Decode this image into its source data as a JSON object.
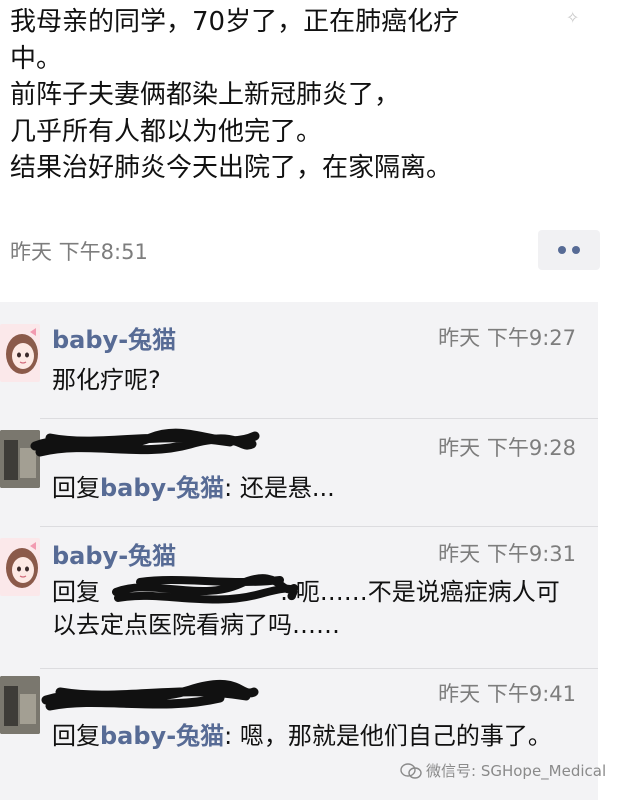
{
  "post": {
    "lines": [
      "我母亲的同学，70岁了，正在肺癌化疗",
      "中。",
      "前阵子夫妻俩都染上新冠肺炎了，",
      "几乎所有人都以为他完了。",
      "结果治好肺炎今天出院了，在家隔离。"
    ],
    "time": "昨天 下午8:51"
  },
  "comments": [
    {
      "name": "baby-兔猫",
      "time": "昨天 下午9:27",
      "text": "那化疗呢?"
    },
    {
      "name": "",
      "time": "昨天 下午9:28",
      "reply_prefix": "回复",
      "reply_to": "baby-兔猫",
      "text": ": 还是悬..."
    },
    {
      "name": "baby-兔猫",
      "time": "昨天 下午9:31",
      "reply_prefix": "回复",
      "reply_to": "",
      "text": ": 呃……不是说癌症病人可以去定点医院看病了吗……"
    },
    {
      "name": "",
      "time": "昨天 下午9:41",
      "reply_prefix": "回复",
      "reply_to": "baby-兔猫",
      "text": ": 嗯，那就是他们自己的事了。"
    }
  ],
  "watermark": "微信号: SGHope_Medical",
  "colors": {
    "link": "#576b95",
    "meta": "#7d7d7d",
    "panel": "#f3f3f5"
  },
  "icons": [
    "more-options-icon",
    "wechat-logo-icon"
  ]
}
